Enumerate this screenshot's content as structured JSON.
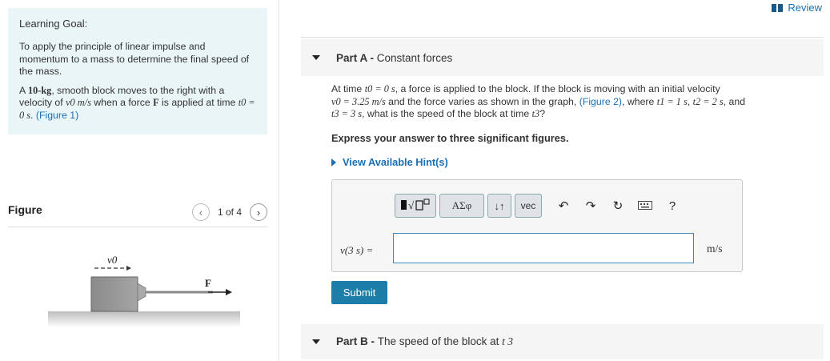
{
  "learning_goal": {
    "title": "Learning Goal:",
    "text": "To apply the principle of linear impulse and momentum to a mass to determine the final speed of the mass.",
    "problem_a": "A ",
    "mass": "10-kg",
    "problem_b": ", smooth block moves to the right with a velocity of ",
    "v0": "v0 m/s",
    "problem_c": " when a force ",
    "force": "F",
    "problem_d": " is applied at time ",
    "t0": "t0 = 0 s",
    "problem_e": ". ",
    "figure_link": "(Figure 1)"
  },
  "figure": {
    "label": "Figure",
    "counter": "1 of 4",
    "prev_icon": "chevron-left-icon",
    "next_icon": "chevron-right-icon",
    "v0_label": "v0",
    "force_label": "F"
  },
  "header": {
    "review_label": "Review",
    "review_icon": "book-icon"
  },
  "part_a": {
    "prefix": "Part A - ",
    "title": "Constant forces",
    "line1_a": "At time ",
    "t0": "t0 = 0 s",
    "line1_b": ", a force is applied to the block. If the block is moving with an initial velocity",
    "v0_eq": "v0 = 3.25 m/s",
    "line2_a": " and the force varies as shown in the graph, ",
    "figure_link": "(Figure 2)",
    "line2_b": ", where ",
    "t1": "t1 = 1 s",
    "t2": "t2 = 2 s",
    "line2_c": ", and",
    "t3": "t3 = 3 s",
    "line3": ", what is the speed of the block at time ",
    "t3_sym": "t3",
    "line3_end": "?",
    "instruction": "Express your answer to three significant figures.",
    "hints_label": "View Available Hint(s)",
    "answer_label": "v(3 s) =",
    "answer_value": "",
    "unit": "m/s",
    "submit_label": "Submit",
    "toolbar": {
      "templates_icon": "templates-icon",
      "greek_label": "ΑΣφ",
      "arrows_label": "↓↑",
      "vec_label": "vec",
      "undo_icon": "undo-icon",
      "redo_icon": "redo-icon",
      "reset_icon": "reset-icon",
      "keyboard_icon": "keyboard-icon",
      "help_label": "?"
    }
  },
  "part_b": {
    "prefix": "Part B - ",
    "title": "The speed of the block at ",
    "t3": "t 3"
  },
  "colors": {
    "link": "#1a6fb5",
    "goal_bg": "#eaf5f8",
    "submit_bg": "#1c7ea8",
    "input_border": "#3d8ac0"
  }
}
